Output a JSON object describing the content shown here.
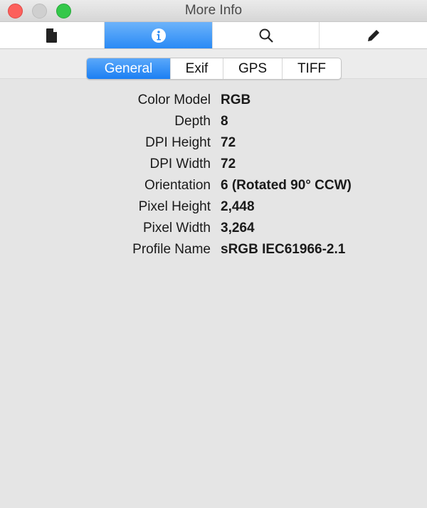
{
  "window": {
    "title": "More Info"
  },
  "toolbar": [
    {
      "icon": "document-icon"
    },
    {
      "icon": "info-icon",
      "active": true
    },
    {
      "icon": "search-icon"
    },
    {
      "icon": "pencil-icon"
    }
  ],
  "tabs": [
    {
      "label": "General",
      "active": true
    },
    {
      "label": "Exif"
    },
    {
      "label": "GPS"
    },
    {
      "label": "TIFF"
    }
  ],
  "properties": [
    {
      "label": "Color Model",
      "value": "RGB"
    },
    {
      "label": "Depth",
      "value": "8"
    },
    {
      "label": "DPI Height",
      "value": "72"
    },
    {
      "label": "DPI Width",
      "value": "72"
    },
    {
      "label": "Orientation",
      "value": "6 (Rotated 90° CCW)"
    },
    {
      "label": "Pixel Height",
      "value": "2,448"
    },
    {
      "label": "Pixel Width",
      "value": "3,264"
    },
    {
      "label": "Profile Name",
      "value": "sRGB IEC61966-2.1"
    }
  ],
  "colors": {
    "accent": "#2a8af5",
    "close": "#fc605c",
    "minimize": "#cfcfcf",
    "zoom": "#34c84a"
  }
}
